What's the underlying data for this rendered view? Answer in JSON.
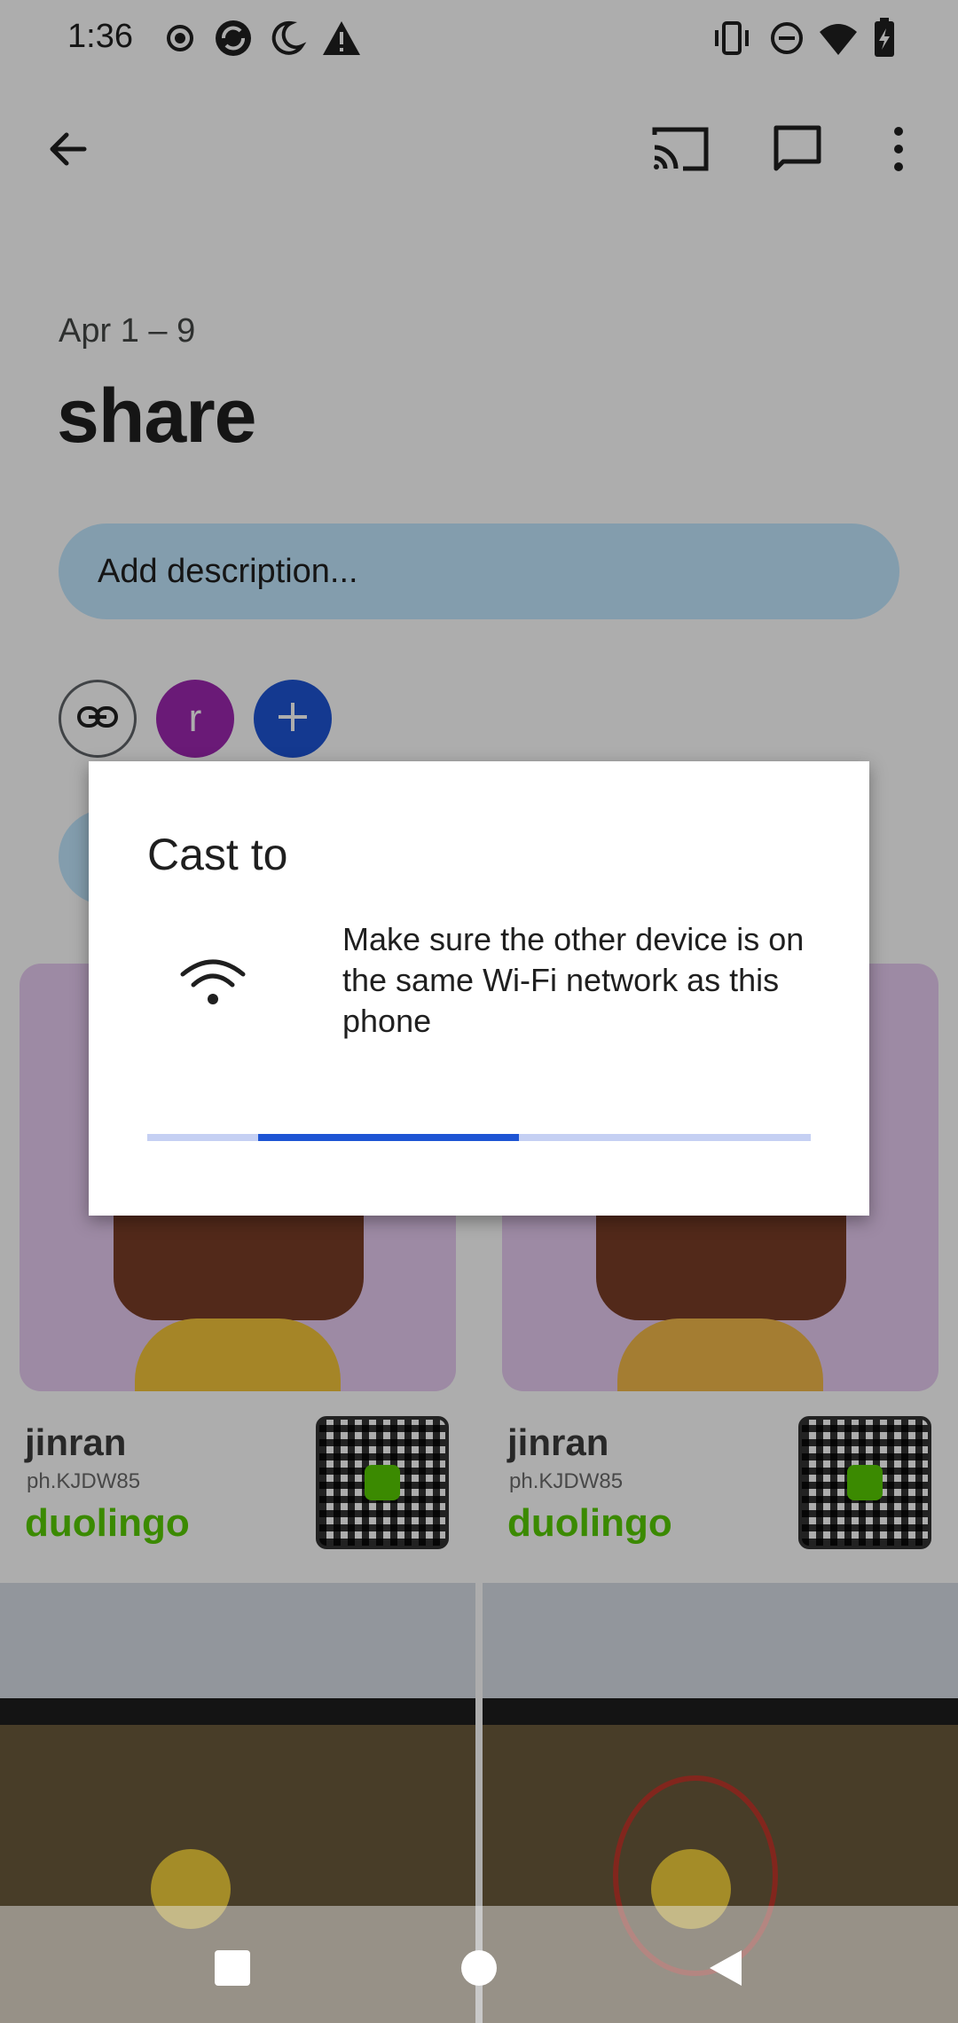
{
  "status_bar": {
    "time": "1:36",
    "left_icons": [
      "record-icon",
      "sync-icon",
      "night-mode-icon",
      "warning-icon"
    ],
    "right_icons": [
      "vibrate-icon",
      "do-not-disturb-icon",
      "wifi-icon",
      "battery-charging-icon"
    ]
  },
  "app_bar": {
    "back_icon": "arrow-back-icon",
    "actions": [
      "cast-icon",
      "comment-icon",
      "more-vert-icon"
    ]
  },
  "album": {
    "date_range": "Apr 1 – 9",
    "title": "share",
    "description_placeholder": "Add description...",
    "member_avatar_letter": "r"
  },
  "photos": [
    {
      "name": "jinran",
      "handle": "ph.KJDW85",
      "brand": "duolingo"
    },
    {
      "name": "jinran",
      "handle": "ph.KJDW85",
      "brand": "duolingo"
    }
  ],
  "dialog": {
    "title": "Cast to",
    "message": "Make sure the other device is on the same Wi-Fi network as this phone",
    "progress_segment": {
      "start": 0.167,
      "end": 0.56
    },
    "progress_color": "#1e55d4"
  },
  "nav_bar": {
    "buttons": [
      "recents-icon",
      "home-icon",
      "back-icon"
    ]
  },
  "colors": {
    "accent": "#1e55d4",
    "pill_bg": "#c2e7ff",
    "avatar": "#9c27b0",
    "duolingo_green": "#58cc02"
  }
}
